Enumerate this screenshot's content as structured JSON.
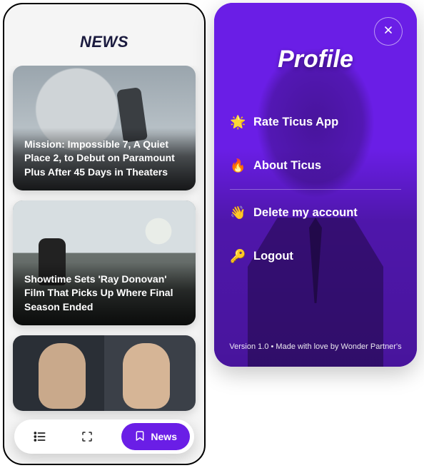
{
  "news": {
    "title": "NEWS",
    "cards": [
      {
        "headline": "Mission: Impossible 7, A Quiet Place 2, to Debut on Paramount Plus After 45 Days in Theaters"
      },
      {
        "headline": "Showtime Sets 'Ray Donovan' Film That Picks Up Where Final Season Ended"
      },
      {
        "headline": ""
      }
    ],
    "bottom_bar": {
      "active_label": "News"
    }
  },
  "profile": {
    "title": "Profile",
    "items": [
      {
        "emoji": "🌟",
        "label": "Rate Ticus App"
      },
      {
        "emoji": "🔥",
        "label": "About Ticus"
      },
      {
        "emoji": "👋",
        "label": "Delete my account"
      },
      {
        "emoji": "🔑",
        "label": "Logout"
      }
    ],
    "footer": "Version 1.0 • Made with love by Wonder Partner's"
  },
  "colors": {
    "accent": "#6a1ee6"
  }
}
